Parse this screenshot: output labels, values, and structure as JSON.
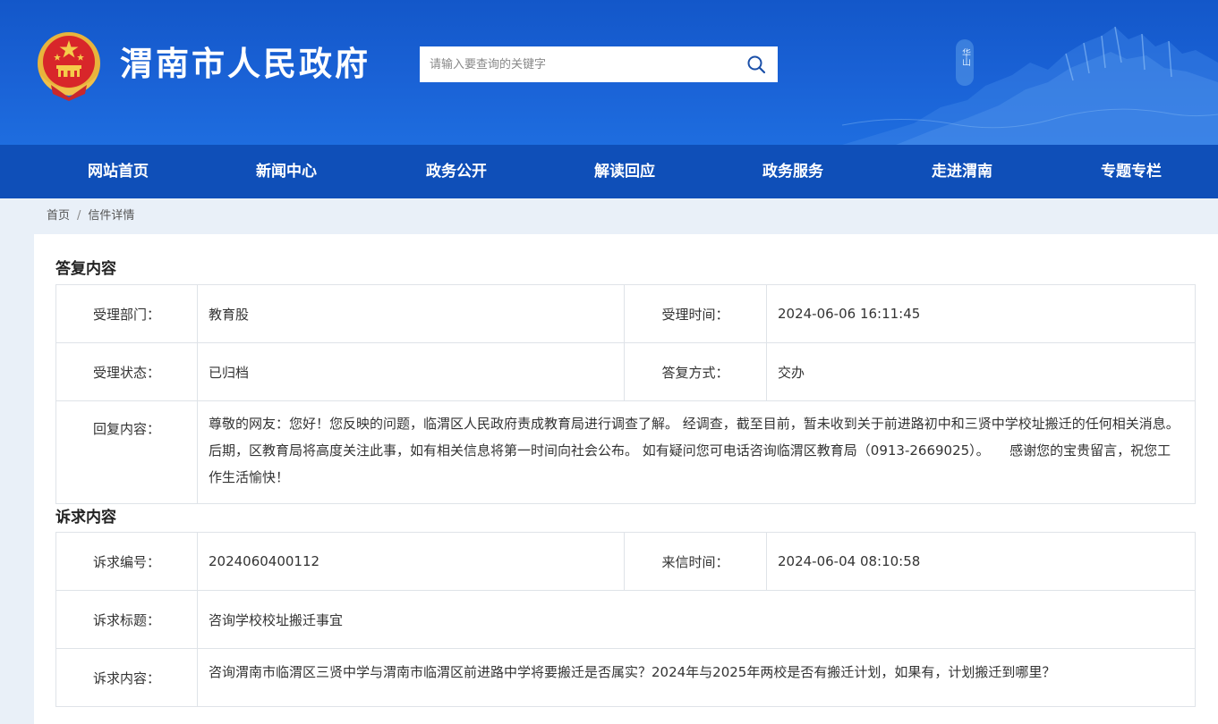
{
  "header": {
    "site_title": "渭南市人民政府",
    "search_placeholder": "请输入要查询的关键字",
    "mountain_caption": "华山"
  },
  "nav": {
    "items": [
      "网站首页",
      "新闻中心",
      "政务公开",
      "解读回应",
      "政务服务",
      "走进渭南",
      "专题专栏"
    ]
  },
  "breadcrumb": {
    "home": "首页",
    "separator": "/",
    "current": "信件详情"
  },
  "reply": {
    "section_title": "答复内容",
    "dept_label": "受理部门：",
    "dept_value": "教育股",
    "time_label": "受理时间：",
    "time_value": "2024-06-06 16:11:45",
    "status_label": "受理状态：",
    "status_value": "已归档",
    "method_label": "答复方式：",
    "method_value": "交办",
    "content_label": "回复内容：",
    "content_value": "尊敬的网友：您好！您反映的问题，临渭区人民政府责成教育局进行调查了解。 经调查，截至目前，暂未收到关于前进路初中和三贤中学校址搬迁的任何相关消息。后期，区教育局将高度关注此事，如有相关信息将第一时间向社会公布。 如有疑问您可电话咨询临渭区教育局（0913-2669025）。　　感谢您的宝贵留言，祝您工作生活愉快！"
  },
  "appeal": {
    "section_title": "诉求内容",
    "number_label": "诉求编号：",
    "number_value": "2024060400112",
    "letter_time_label": "来信时间：",
    "letter_time_value": "2024-06-04 08:10:58",
    "title_label": "诉求标题：",
    "title_value": "咨询学校校址搬迁事宜",
    "content_label": "诉求内容：",
    "content_value": "咨询渭南市临渭区三贤中学与渭南市临渭区前进路中学将要搬迁是否属实？2024年与2025年两校是否有搬迁计划，如果有，计划搬迁到哪里？"
  },
  "colors": {
    "header_blue": "#1a62d6",
    "nav_blue": "#0f4fb8",
    "page_bg": "#e9f0f8",
    "border": "#dfe3e8"
  }
}
